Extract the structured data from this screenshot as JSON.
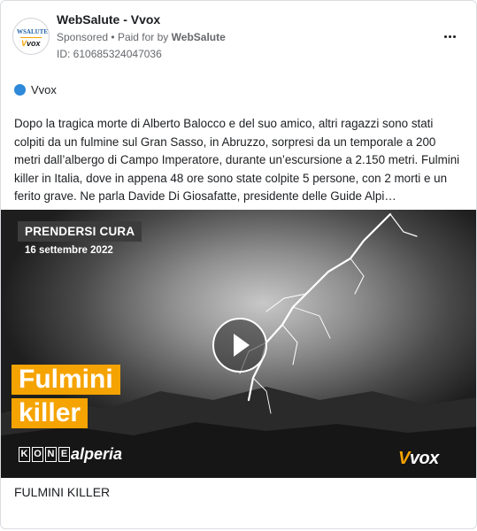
{
  "header": {
    "page_name": "WebSalute - Vvox",
    "sponsored_label": "Sponsored",
    "paid_for_prefix": "Paid for by",
    "paid_for_name": "WebSalute",
    "ad_id": "ID: 610685324047036",
    "avatar_top": "WebSalute",
    "avatar_bottom": "Vvox"
  },
  "platform": {
    "name": "Vvox",
    "dot_color": "#2e89d9"
  },
  "post": {
    "text": "Dopo la tragica morte di Alberto Balocco e del suo amico, altri ragazzi sono stati colpiti da un fulmine sul Gran Sasso, in Abruzzo, sorpresi da un temporale a 200 metri dall’albergo di Campo Imperatore, durante un’escursione a 2.150 metri. Fulmini killer in Italia, dove in appena 48 ore sono state colpite 5 persone, con 2 morti e un ferito grave. Ne parla Davide Di Giosafatte, presidente delle Guide Alpi…"
  },
  "video": {
    "tag": "PRENDERSI CURA",
    "date": "16 settembre 2022",
    "title_line1": "Fulmini",
    "title_line2": "killer",
    "sponsor1_letters": [
      "K",
      "O",
      "N",
      "E"
    ],
    "sponsor2": "alperia",
    "brand_v": "V",
    "brand_rest": "vox",
    "accent_color": "#f5a300"
  },
  "caption": "FULMINI KILLER"
}
